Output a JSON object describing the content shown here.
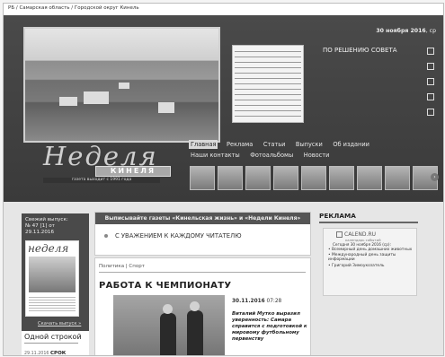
{
  "breadcrumb": "РБ / Самарская область / Городской округ Кинель",
  "header": {
    "date": "30 ноября 2016",
    "weekday": ", ср",
    "sovet": "ПО РЕШЕНИЮ СОВЕТА",
    "logo_main": "Неделя",
    "logo_city": "КИНЕЛЯ",
    "logo_sub": "газета выходит с 1991 года"
  },
  "nav": {
    "items": [
      "Главная",
      "Реклама",
      "Статьи",
      "Выпуски",
      "Об издании",
      "Наши контакты",
      "Фотоальбомы",
      "Новости"
    ]
  },
  "issue": {
    "label": "Свежий выпуск:",
    "number": "№ 47 [1] от",
    "date": "29.11.2016",
    "cover_title": "неделя",
    "download": "Скачать выпуск »"
  },
  "one_line": {
    "heading": "Одной строкой",
    "date": "29.11.2016",
    "title": "СРОК"
  },
  "banner": {
    "subscribe": "Выписывайте газеты «Кинельская жизнь» и «Недели Кинеля»",
    "respect": "С УВАЖЕНИЕМ К КАЖДОМУ ЧИТАТЕЛЮ"
  },
  "article": {
    "categories": "Политика | Спорт",
    "title": "РАБОТА К ЧЕМПИОНАТУ",
    "date": "30.11.2016",
    "time": "07:28",
    "lead": "Виталий Мутко выразил уверенность: Самара справится с подготовкой к мировому футбольному первенству"
  },
  "ads": {
    "heading": "РЕКЛАМА",
    "calendar": "CALEND.RU",
    "calendar_sub": "календарь событий",
    "today": "Сегодня 30 ноября 2016 (ср):",
    "items": [
      "• Всемирный день домашних животных",
      "• Международный день защиты информации",
      "• Григорий Зимоукозатель"
    ]
  }
}
